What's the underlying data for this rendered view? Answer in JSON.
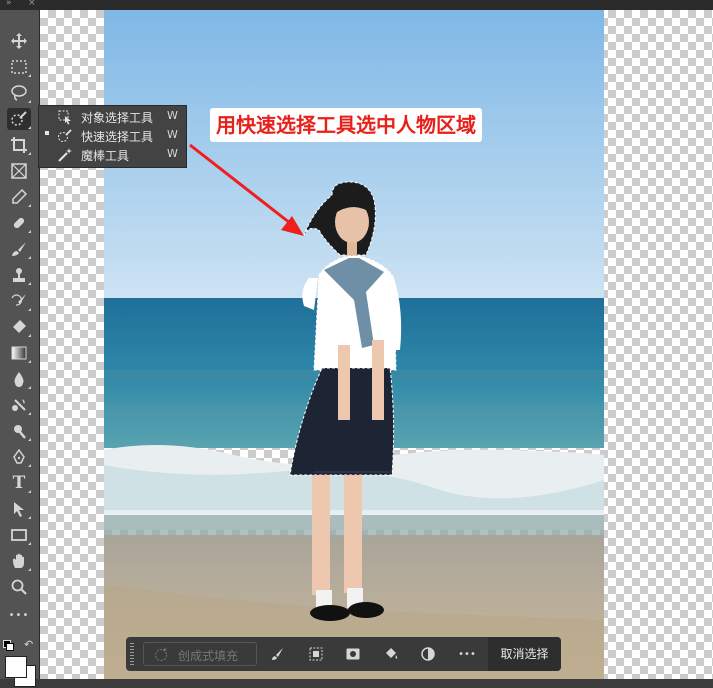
{
  "window": {
    "collapse_glyph": "»",
    "close_glyph": "×"
  },
  "toolbar": {
    "tools": [
      {
        "name": "move-tool-icon"
      },
      {
        "name": "marquee-tool-icon"
      },
      {
        "name": "lasso-tool-icon"
      },
      {
        "name": "quick-selection-tool-icon",
        "active": true
      },
      {
        "name": "crop-tool-icon"
      },
      {
        "name": "frame-tool-icon"
      },
      {
        "name": "eyedropper-tool-icon"
      },
      {
        "name": "spot-healing-tool-icon"
      },
      {
        "name": "brush-tool-icon"
      },
      {
        "name": "clone-stamp-tool-icon"
      },
      {
        "name": "history-brush-tool-icon"
      },
      {
        "name": "eraser-tool-icon"
      },
      {
        "name": "gradient-tool-icon"
      },
      {
        "name": "blur-tool-icon"
      },
      {
        "name": "dodge-tool-icon"
      },
      {
        "name": "sponge-tool-icon"
      },
      {
        "name": "pen-tool-icon"
      },
      {
        "name": "type-tool-icon",
        "glyph": "T"
      },
      {
        "name": "path-selection-tool-icon"
      },
      {
        "name": "rectangle-tool-icon"
      },
      {
        "name": "hand-tool-icon"
      },
      {
        "name": "zoom-tool-icon"
      },
      {
        "name": "more-tools-icon",
        "glyph": "•••"
      }
    ],
    "foreground_color": "#ffffff",
    "background_color": "#ffffff"
  },
  "flyout": {
    "items": [
      {
        "label": "对象选择工具",
        "shortcut": "W",
        "icon": "object-selection-icon",
        "selected": false
      },
      {
        "label": "快速选择工具",
        "shortcut": "W",
        "icon": "quick-selection-icon",
        "selected": true
      },
      {
        "label": "魔棒工具",
        "shortcut": "W",
        "icon": "magic-wand-icon",
        "selected": false
      }
    ]
  },
  "annotation": {
    "text": "用快速选择工具选中人物区域",
    "color": "#e8201a"
  },
  "context_bar": {
    "generative_fill_label": "创成式填充",
    "deselect_label": "取消选择",
    "more_glyph": "•••"
  }
}
